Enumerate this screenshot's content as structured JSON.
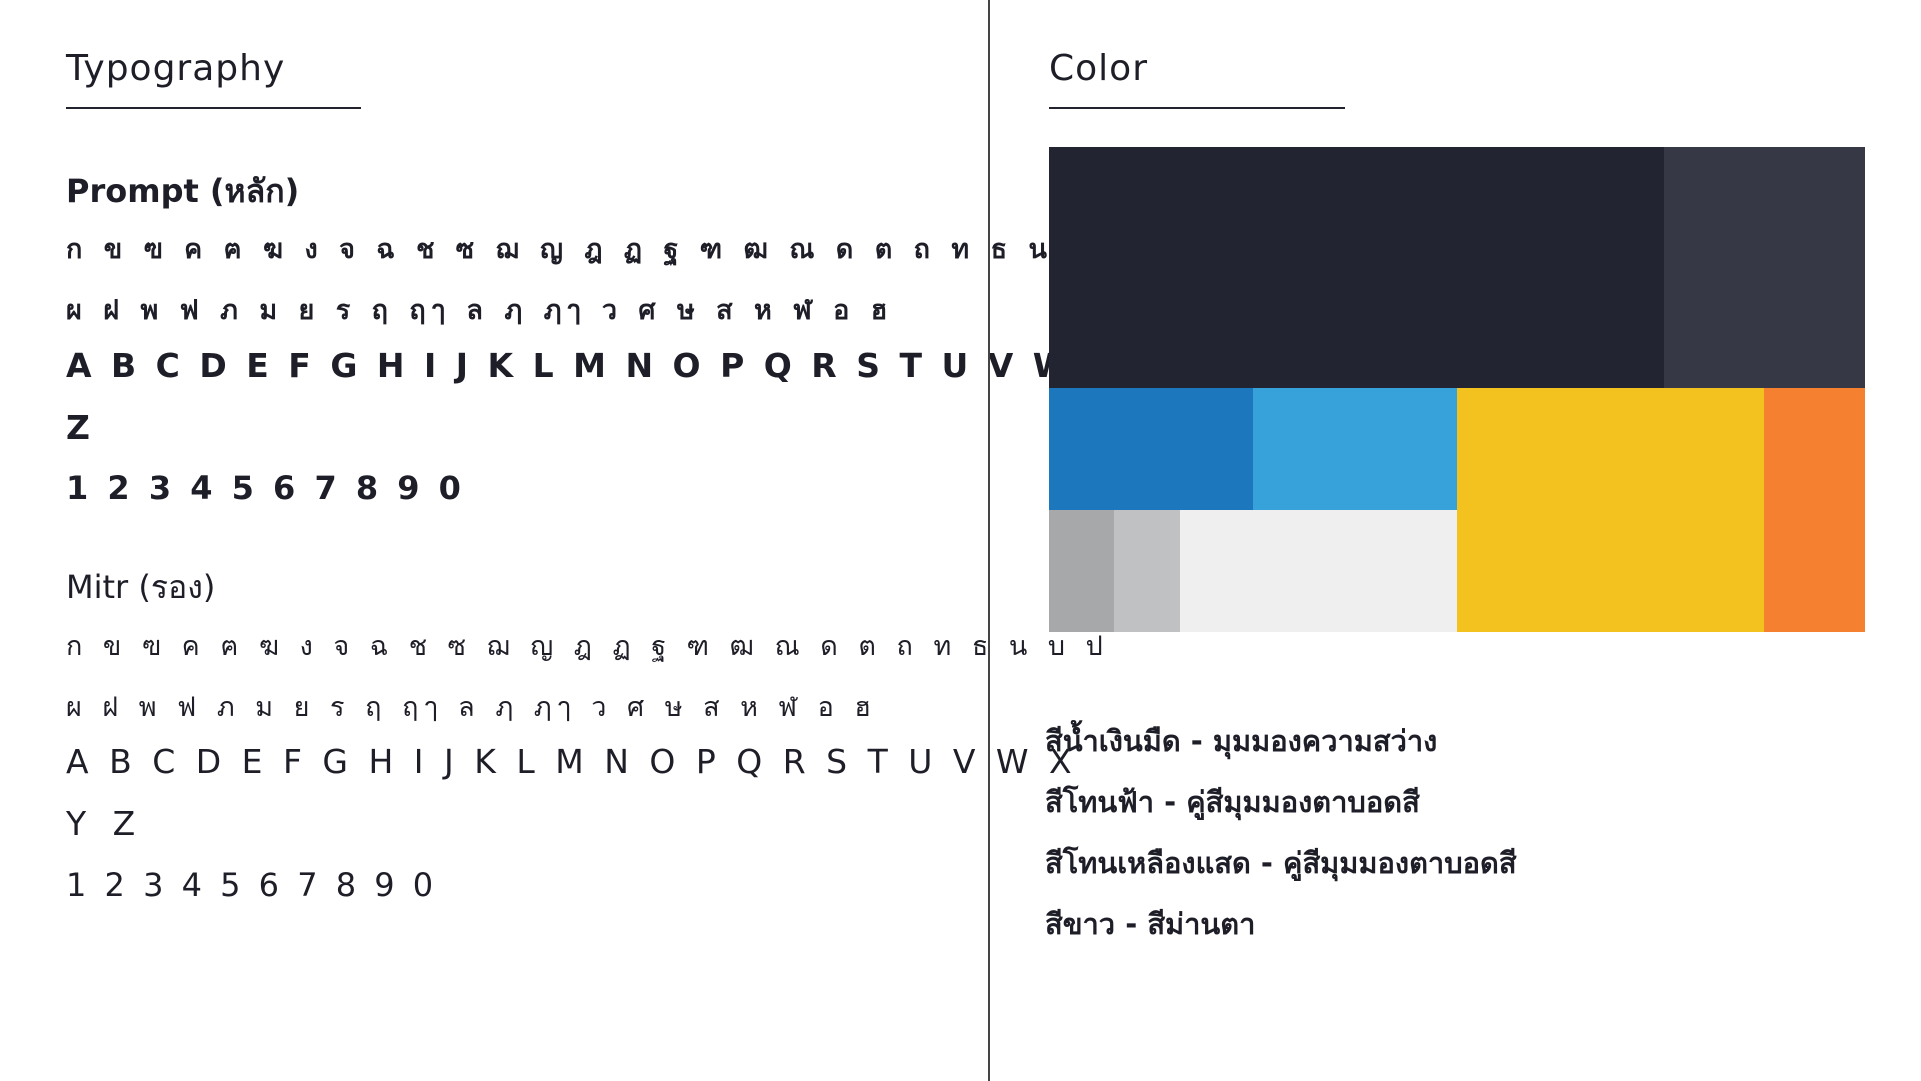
{
  "typography": {
    "title": "Typography",
    "primary": {
      "name": "Prompt (หลัก)",
      "thai_line_1": "ก ข ฃ ค ฅ ฆ ง จ ฉ ช ซ ฌ ญ ฎ ฏ ฐ ฑ ฒ ณ ด ต ถ ท ธ น บ ป",
      "thai_line_2": "ผ ฝ พ ฟ ภ ม ย ร ฤ ฤๅ ล ฦ ฦๅ ว ศ ษ ส ห ฬ อ ฮ",
      "latin_line_1": "A B C D E F G H I J K L M N O P Q R S T U V W X Y",
      "latin_line_2": "Z",
      "digits": "1 2 3 4 5 6 7 8 9 0"
    },
    "secondary": {
      "name": "Mitr (รอง)",
      "thai_line_1": "ก ข ฃ ค ฅ ฆ ง จ ฉ ช ซ ฌ ญ ฎ ฏ ฐ ฑ ฒ ณ ด ต ถ ท ธ น บ ป",
      "thai_line_2": "ผ ฝ พ ฟ ภ ม ย ร ฤ ฤๅ ล ฦ ฦๅ ว ศ ษ ส ห ฬ อ ฮ",
      "latin_line_1": "A B C D E F G H I J K L M N O P Q R S T U V W X",
      "latin_line_2": "Y Z",
      "digits": "1 2 3 4 5 6 7 8 9 0"
    }
  },
  "color": {
    "title": "Color",
    "swatches": {
      "navy_dark": "#232432",
      "navy_light": "#373845",
      "blue_dark": "#1c77bd",
      "blue_light": "#37a1da",
      "yellow": "#f4c21e",
      "orange": "#f58130",
      "gray_dark": "#a7a8aa",
      "gray_light": "#c0c1c2",
      "white": "#efefef"
    },
    "descriptions": [
      "สีน้ำเงินมืด - มุมมองความสว่าง",
      "สีโทนฟ้า - คู่สีมุมมองตาบอดสี",
      "สีโทนเหลืองแสด - คู่สีมุมมองตาบอดสี",
      "สีขาว - สีม่านตา"
    ]
  }
}
